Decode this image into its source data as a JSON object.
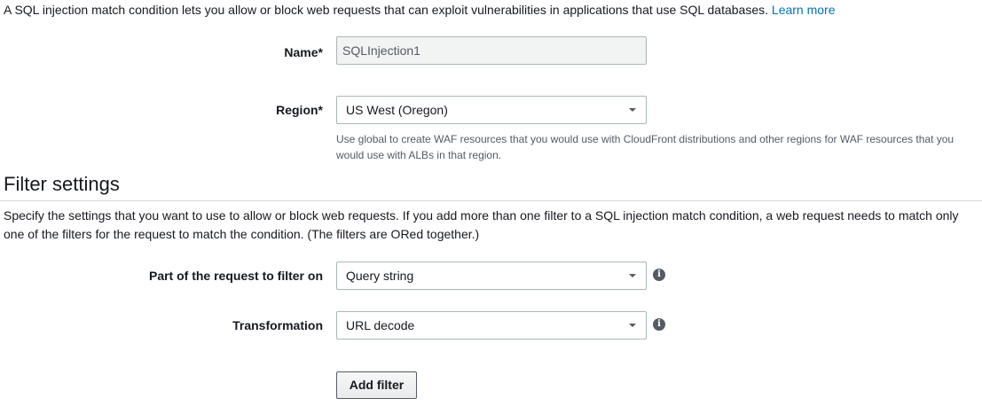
{
  "intro": {
    "text": "A SQL injection match condition lets you allow or block web requests that can exploit vulnerabilities in applications that use SQL databases.",
    "link": "Learn more"
  },
  "name_field": {
    "label": "Name*",
    "value": "SQLInjection1"
  },
  "region_field": {
    "label": "Region*",
    "value": "US West (Oregon)",
    "help": "Use global to create WAF resources that you would use with CloudFront distributions and other regions for WAF resources that you would use with ALBs in that region."
  },
  "filter_settings": {
    "title": "Filter settings",
    "description": "Specify the settings that you want to use to allow or block web requests. If you add more than one filter to a SQL injection match condition, a web request needs to match only one of the filters for the request to match the condition. (The filters are ORed together.)",
    "part_label": "Part of the request to filter on",
    "part_value": "Query string",
    "transformation_label": "Transformation",
    "transformation_value": "URL decode",
    "add_filter_label": "Add filter"
  },
  "icons": {
    "info": "info-icon",
    "dropdown": "chevron-down-icon"
  },
  "colors": {
    "link": "#0073bb",
    "text": "#16191f",
    "muted": "#545b64",
    "border": "#aab7b8"
  }
}
